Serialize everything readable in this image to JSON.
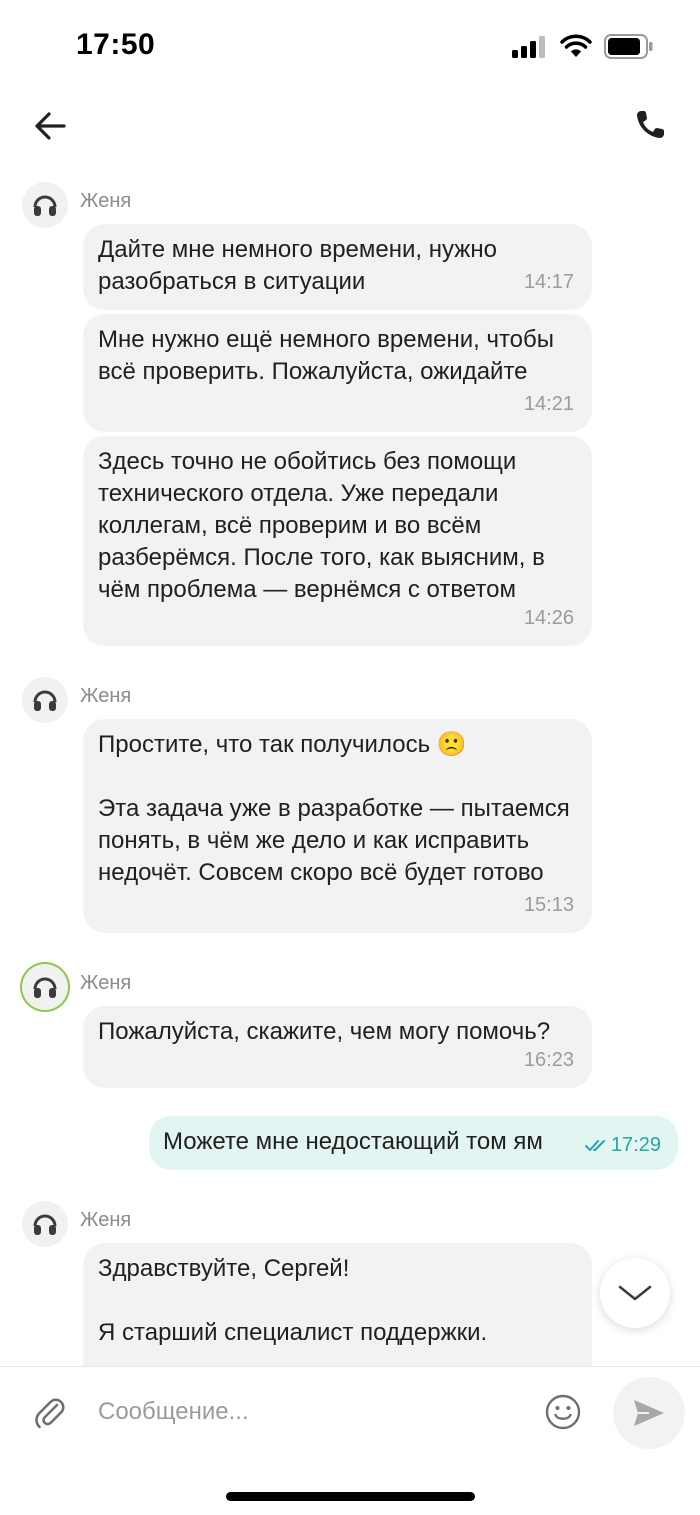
{
  "status_bar": {
    "time": "17:50"
  },
  "header": {
    "back_icon": "arrow-left-icon",
    "call_icon": "phone-icon"
  },
  "colors": {
    "incoming_bubble": "#f2f2f4",
    "outgoing_bubble": "#e3f5f3",
    "outgoing_time": "#2aa3a3",
    "online_ring": "#8dc84a"
  },
  "messages": [
    {
      "sender": "Женя",
      "bubbles": [
        {
          "text": "Дайте мне немного времени, нужно разобраться в ситуации",
          "time": "14:17"
        },
        {
          "text": "Мне нужно ещё немного времени, чтобы всё проверить. Пожалуйста, ожидайте",
          "time": "14:21"
        },
        {
          "text": "Здесь точно не обойтись без помощи технического отдела. Уже передали коллегам, всё проверим и во всём разберёмся. После того, как выясним, в чём проблема — вернёмся с ответом",
          "time": "14:26"
        }
      ]
    },
    {
      "sender": "Женя",
      "bubbles": [
        {
          "text": "Простите, что так получилось 🙁\n\nЭта задача уже в разработке — пытаемся понять, в чём же дело и как исправить недочёт. Совсем скоро всё будет готово",
          "time": "15:13"
        }
      ]
    },
    {
      "sender": "Женя",
      "bubbles": [
        {
          "text": "Пожалуйста, скажите, чем могу помочь?",
          "time": "16:23"
        }
      ]
    },
    {
      "outgoing": true,
      "text": "Можете мне недостающий том ям",
      "time": "17:29",
      "status_icon": "double-check-icon"
    },
    {
      "sender": "Женя",
      "bubbles": [
        {
          "text": "Здравствуйте, Сергей!\n\nЯ старший специалист поддержки.",
          "time": ""
        }
      ]
    }
  ],
  "composer": {
    "placeholder": "Сообщение...",
    "attach_icon": "paperclip-icon",
    "emoji_icon": "smile-icon",
    "send_icon": "send-icon"
  }
}
